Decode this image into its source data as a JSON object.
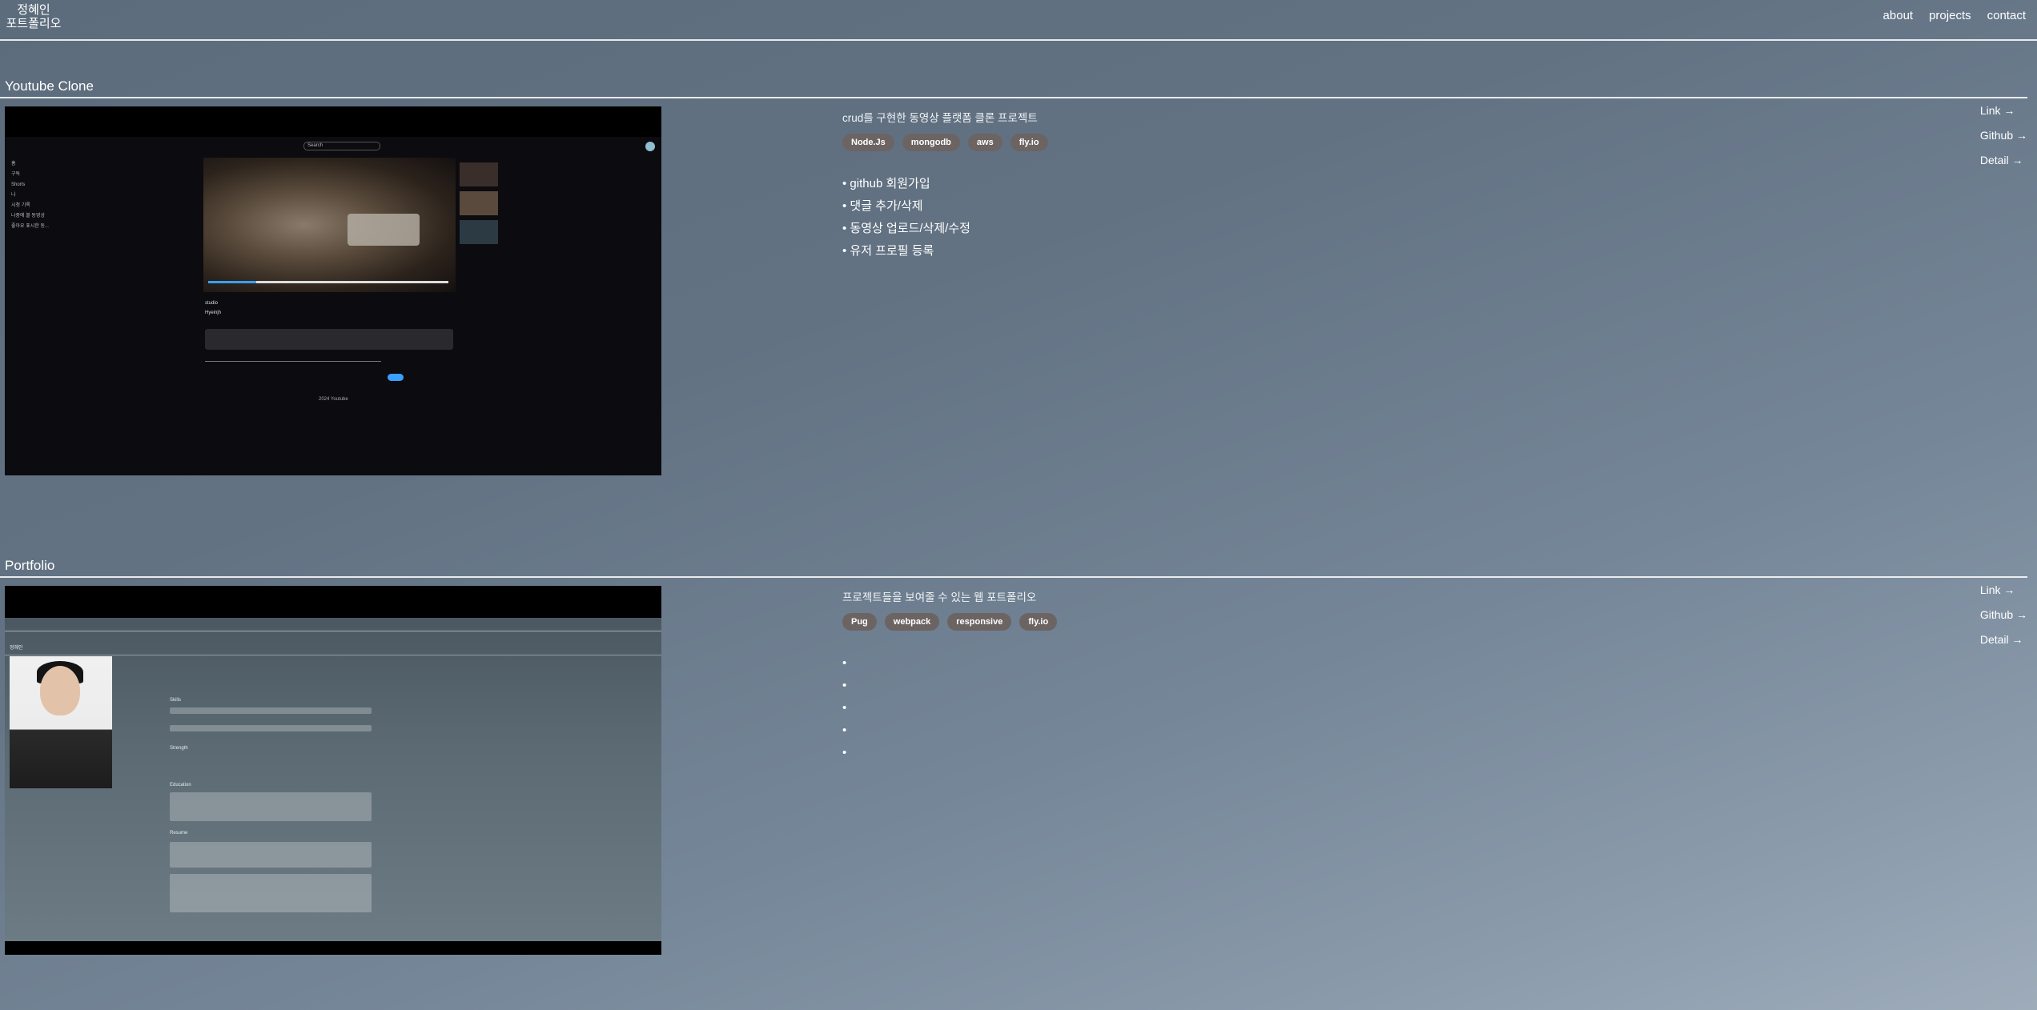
{
  "header": {
    "logo_line1": "정혜인",
    "logo_line2": "포트폴리오",
    "nav": [
      "about",
      "projects",
      "contact"
    ]
  },
  "projects": [
    {
      "title": "Youtube Clone",
      "description": "crud를 구현한 동영상 플랫폼 클론 프로젝트",
      "tags": [
        "Node.Js",
        "mongodb",
        "aws",
        "fly.io"
      ],
      "features": [
        "• github 회원가입",
        "• 댓글 추가/삭제",
        "• 동영상 업로드/삭제/수정",
        "• 유저 프로필 등록"
      ],
      "links": [
        "Link →",
        "Github →",
        "Detail →"
      ],
      "screenshot": {
        "search_placeholder": "Search",
        "sidebar": [
          "홈",
          "구독",
          "Shorts",
          "나",
          "시청 기록",
          "나중에 볼 동영상",
          "좋아요 표시한 동..."
        ],
        "video_title": "studio",
        "channel": "Hyeinjh",
        "footer": "2024 Youtube"
      }
    },
    {
      "title": "Portfolio",
      "description": "프로젝트들을 보여줄 수 있는 웹 포트폴리오",
      "tags": [
        "Pug",
        "webpack",
        "responsive",
        "fly.io"
      ],
      "features": [
        "•",
        "•",
        "•",
        "•",
        "•"
      ],
      "links": [
        "Link →",
        "Github →",
        "Detail →"
      ],
      "screenshot": {
        "name": "정혜인",
        "sections": [
          "Skills",
          "Strength",
          "Education",
          "Resume"
        ]
      }
    }
  ],
  "colors": {
    "tag_bg": "#6b6463",
    "accent_blue": "#3aa0ff"
  }
}
